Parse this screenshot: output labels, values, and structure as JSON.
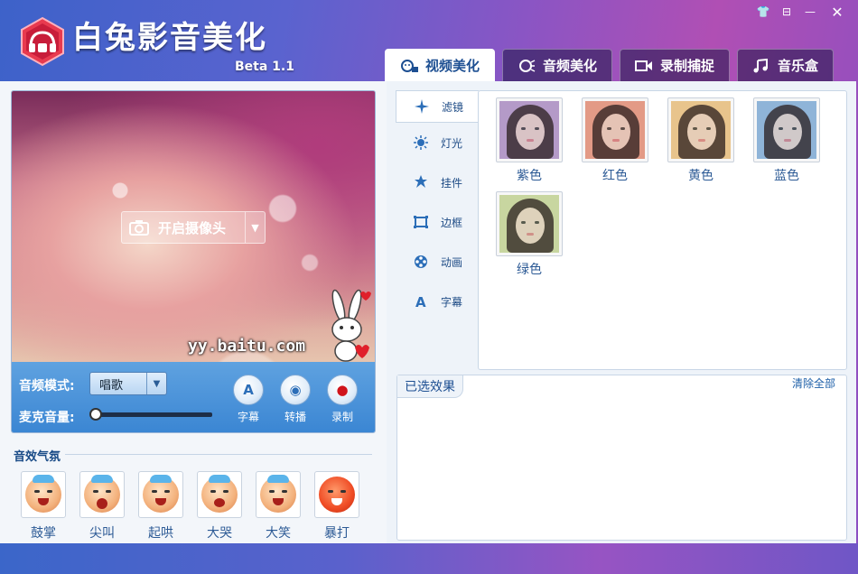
{
  "app": {
    "title": "白兔影音美化",
    "version": "Beta 1.1"
  },
  "window_controls": [
    {
      "name": "skin-icon",
      "glyph": "👕"
    },
    {
      "name": "menu-icon",
      "glyph": "⊟"
    },
    {
      "name": "minimize-icon",
      "glyph": "—"
    },
    {
      "name": "close-icon",
      "glyph": "✕"
    }
  ],
  "tabs": [
    {
      "label": "视频美化",
      "icon": "video-face-icon",
      "active": true
    },
    {
      "label": "音频美化",
      "icon": "audio-face-icon",
      "active": false
    },
    {
      "label": "录制捕捉",
      "icon": "record-camera-icon",
      "active": false
    },
    {
      "label": "音乐盒",
      "icon": "music-note-icon",
      "active": false
    }
  ],
  "video": {
    "camera_button": "开启摄像头",
    "watermark": "yy.baitu.com"
  },
  "controls": {
    "audio_mode_label": "音频模式:",
    "audio_mode_value": "唱歌",
    "mic_volume_label": "麦克音量:",
    "mic_volume_level": 0.0,
    "buttons": [
      {
        "label": "字幕",
        "glyph": "A"
      },
      {
        "label": "转播",
        "glyph": "◉"
      },
      {
        "label": "录制",
        "glyph": "●"
      }
    ]
  },
  "sound_effects": {
    "title": "音效气氛",
    "items": [
      "鼓掌",
      "尖叫",
      "起哄",
      "大哭",
      "大笑",
      "暴打"
    ]
  },
  "categories": [
    {
      "label": "滤镜",
      "icon": "sparkle-icon",
      "active": true
    },
    {
      "label": "灯光",
      "icon": "sun-icon",
      "active": false
    },
    {
      "label": "挂件",
      "icon": "pendant-icon",
      "active": false
    },
    {
      "label": "边框",
      "icon": "frame-icon",
      "active": false
    },
    {
      "label": "动画",
      "icon": "film-reel-icon",
      "active": false
    },
    {
      "label": "字幕",
      "icon": "letter-a-icon",
      "active": false
    }
  ],
  "filters": [
    {
      "label": "紫色",
      "tint": "#b59ac9"
    },
    {
      "label": "红色",
      "tint": "#e39a86"
    },
    {
      "label": "黄色",
      "tint": "#e8c48c"
    },
    {
      "label": "蓝色",
      "tint": "#8fb4d8"
    },
    {
      "label": "绿色",
      "tint": "#c9d6a0"
    }
  ],
  "selected_effects": {
    "title": "已选效果",
    "clear_all": "清除全部"
  },
  "colors": {
    "accent": "#1d4f92",
    "control_bar": "#3b86d3",
    "record_red": "#d0141b"
  }
}
